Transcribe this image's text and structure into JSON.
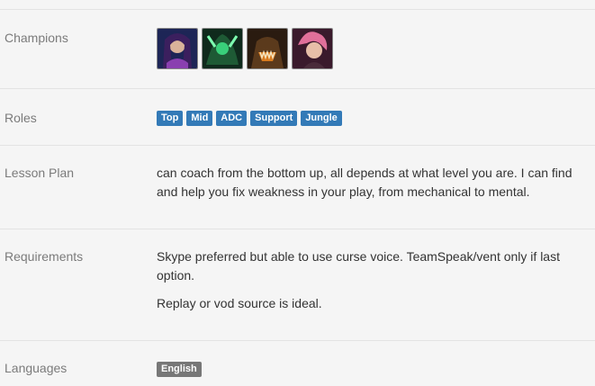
{
  "sections": {
    "champions": {
      "label": "Champions",
      "items": [
        {
          "icon": "champion-portrait-1-icon",
          "bg": "#1d2556",
          "accent": "#8a3fb0"
        },
        {
          "icon": "champion-portrait-2-icon",
          "bg": "#0f2a1c",
          "accent": "#39d07a"
        },
        {
          "icon": "champion-portrait-3-icon",
          "bg": "#2a1b10",
          "accent": "#d77a1e"
        },
        {
          "icon": "champion-portrait-4-icon",
          "bg": "#3a1a2c",
          "accent": "#e0709a"
        }
      ]
    },
    "roles": {
      "label": "Roles",
      "items": [
        "Top",
        "Mid",
        "ADC",
        "Support",
        "Jungle"
      ],
      "badge_color": "#337ab7"
    },
    "lesson_plan": {
      "label": "Lesson Plan",
      "text": "can coach from the bottom up, all depends at what level you are. I can find and help you fix weakness in your play, from mechanical to mental."
    },
    "requirements": {
      "label": "Requirements",
      "text1": "Skype preferred but able to use curse voice. TeamSpeak/vent only if last option.",
      "text2": "Replay or vod source is ideal."
    },
    "languages": {
      "label": "Languages",
      "items": [
        "English"
      ],
      "badge_color": "#777777"
    }
  }
}
